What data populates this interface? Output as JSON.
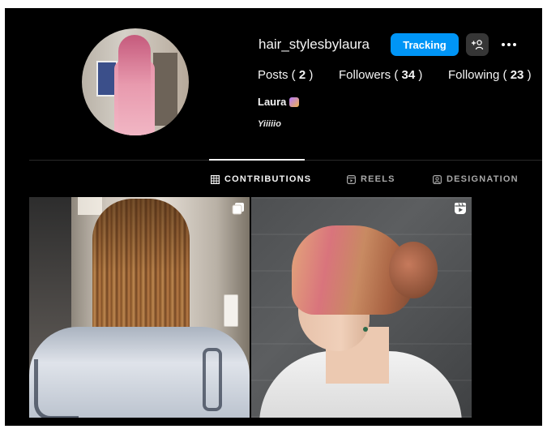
{
  "profile": {
    "username": "hair_stylesbylaura",
    "follow_button": "Tracking",
    "name": "Laura",
    "bio": "Yiiiiio"
  },
  "stats": {
    "posts_label": "Posts",
    "posts_count": "2",
    "followers_label": "Followers",
    "followers_count": "34",
    "following_label": "Following",
    "following_count": "23"
  },
  "tabs": [
    {
      "label": "CONTRIBUTIONS",
      "icon": "grid-icon",
      "active": true
    },
    {
      "label": "REELS",
      "icon": "reels-icon",
      "active": false
    },
    {
      "label": "DESIGNATION",
      "icon": "tagged-icon",
      "active": false
    }
  ],
  "posts": [
    {
      "type": "carousel",
      "badge_icon": "carousel-icon"
    },
    {
      "type": "reel",
      "badge_icon": "reel-icon"
    }
  ],
  "colors": {
    "background": "#000000",
    "accent": "#0095f6",
    "secondary_button": "#363636",
    "text_primary": "#f5f5f5",
    "text_secondary": "#a8a8a8"
  }
}
